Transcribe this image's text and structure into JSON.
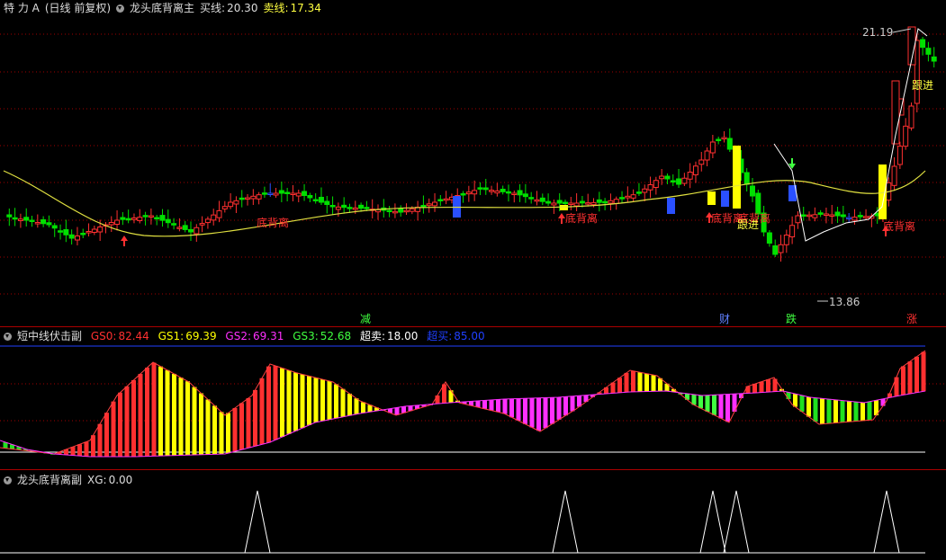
{
  "main_panel": {
    "stock_name": "特 力 A",
    "period": "(日线 前复权)",
    "indicator_name": "龙头底背离主",
    "buy_label": "买线:",
    "buy_value": "20.30",
    "sell_label": "卖线:",
    "sell_value": "17.34",
    "high_price": "21.19",
    "low_price": "13.86",
    "signal_labels": [
      "底背离",
      "底背离",
      "底背离",
      "底背离",
      "底背离"
    ],
    "follow_labels": [
      "跟进",
      "跟进"
    ],
    "event_markers": [
      "减",
      "财",
      "跌",
      "涨"
    ]
  },
  "sub_panel1": {
    "indicator_name": "短中线伏击副",
    "items": [
      {
        "label": "GS0:",
        "value": "82.44",
        "color": "#ff3030"
      },
      {
        "label": "GS1:",
        "value": "69.39",
        "color": "#ffff00"
      },
      {
        "label": "GS2:",
        "value": "69.31",
        "color": "#ff30ff"
      },
      {
        "label": "GS3:",
        "value": "52.68",
        "color": "#40ff40"
      },
      {
        "label": "超卖:",
        "value": "18.00",
        "color": "#ffffff"
      },
      {
        "label": "超买:",
        "value": "85.00",
        "color": "#2040ff"
      }
    ]
  },
  "sub_panel2": {
    "indicator_name": "龙头底背离副",
    "xg_label": "XG:",
    "xg_value": "0.00"
  },
  "colors": {
    "up": "#ff3030",
    "down": "#00e000",
    "flat": "#2a50ff",
    "signal": "#ffff00",
    "ma": "#e0e040",
    "grid": "#a00000"
  }
}
